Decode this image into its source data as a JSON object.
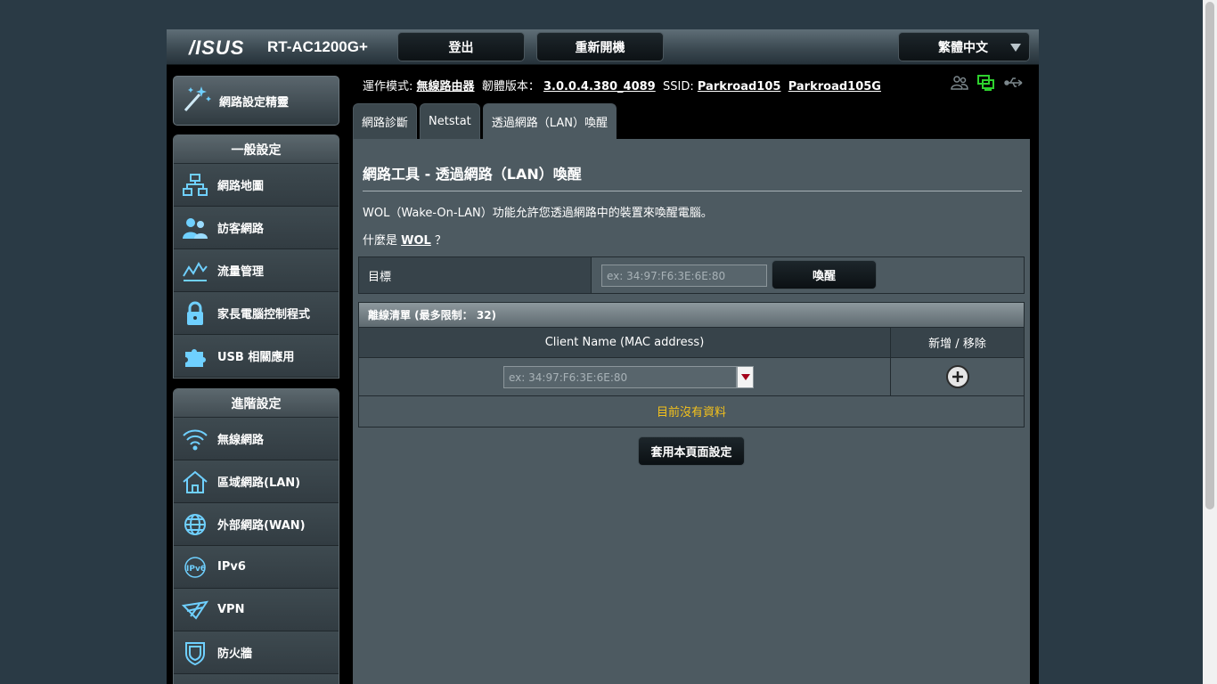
{
  "header": {
    "logo": "/ISUS",
    "model": "RT-AC1200G+",
    "logout": "登出",
    "reboot": "重新開機",
    "language": "繁體中文"
  },
  "sidebar": {
    "wizard": "網路設定精靈",
    "general": {
      "title": "一般設定",
      "items": [
        {
          "label": "網路地圖",
          "icon": "network-map-icon"
        },
        {
          "label": "訪客網路",
          "icon": "guest-network-icon"
        },
        {
          "label": "流量管理",
          "icon": "traffic-manager-icon"
        },
        {
          "label": "家長電腦控制程式",
          "icon": "parental-lock-icon"
        },
        {
          "label": "USB 相關應用",
          "icon": "usb-puzzle-icon"
        }
      ]
    },
    "advanced": {
      "title": "進階設定",
      "items": [
        {
          "label": "無線網路",
          "icon": "wifi-icon"
        },
        {
          "label": "區域網路(LAN)",
          "icon": "home-icon"
        },
        {
          "label": "外部網路(WAN)",
          "icon": "globe-icon"
        },
        {
          "label": "IPv6",
          "icon": "ipv6-icon"
        },
        {
          "label": "VPN",
          "icon": "vpn-icon"
        },
        {
          "label": "防火牆",
          "icon": "shield-icon"
        }
      ]
    }
  },
  "status": {
    "mode_label": "運作模式:",
    "mode_value": "無線路由器",
    "fw_label": "韌體版本：",
    "fw_value": "3.0.0.4.380_4089",
    "ssid_label": "SSID:",
    "ssid_1": "Parkroad105",
    "ssid_2": "Parkroad105G",
    "icons": [
      "clients-icon",
      "network-status-icon",
      "usb-status-icon"
    ],
    "accent": "#2ed12e"
  },
  "tabs": [
    "網路診斷",
    "Netstat",
    "透過網路（LAN）喚醒"
  ],
  "main": {
    "title": "網路工具 - 透過網路（LAN）喚醒",
    "desc": "WOL（Wake-On-LAN）功能允許您透過網路中的裝置來喚醒電腦。",
    "what_prefix": "什麼是",
    "what_link": "WOL",
    "what_suffix": "？",
    "target_label": "目標",
    "target_placeholder": "ex: 34:97:F6:3E:6E:80",
    "wake_button": "喚醒",
    "offline_title": "離線清單 (最多限制： 32)",
    "col_client": "Client Name (MAC address)",
    "col_addremove": "新增 / 移除",
    "client_placeholder": "ex: 34:97:F6:3E:6E:80",
    "no_data": "目前沒有資料",
    "apply_button": "套用本頁面設定",
    "no_data_color": "#f5c21b"
  }
}
